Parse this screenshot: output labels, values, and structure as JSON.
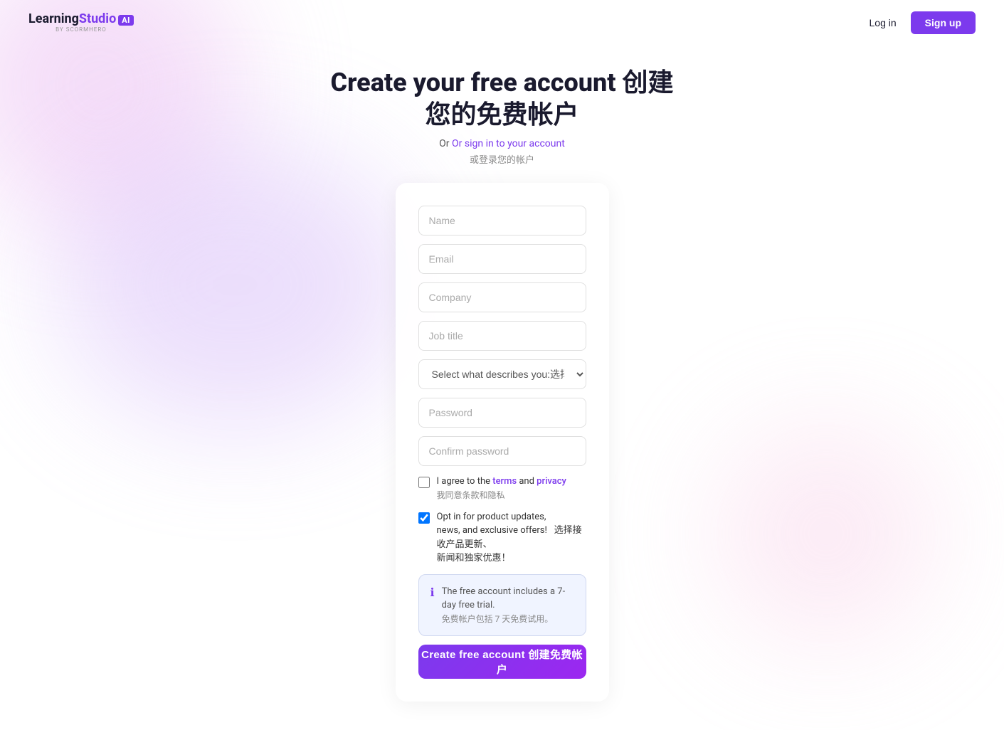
{
  "header": {
    "logo": {
      "learning": "Learning",
      "studio": "Studio",
      "ai": "AI",
      "byline": "by SCORMHERO"
    },
    "nav": {
      "login_label": "Log in",
      "signup_label": "Sign up"
    }
  },
  "page": {
    "title_en": "Create your free account 创建",
    "title_cn": "您的免费帐户",
    "subtitle_en": "Or sign in to your account",
    "subtitle_cn": "或登录您的帐户"
  },
  "form": {
    "name_placeholder": "Name",
    "email_placeholder": "Email",
    "company_placeholder": "Company",
    "job_title_placeholder": "Job title",
    "select_placeholder": "Select what describes you:选择描述您的内容",
    "password_placeholder": "Password",
    "confirm_password_placeholder": "Confirm password",
    "agree_text": "I agree to the ",
    "terms_label": "terms",
    "and_text": " and ",
    "privacy_label": "privacy",
    "agree_cn": "我同意条款和隐私",
    "optin_line1": "Opt in for product updates,",
    "optin_line2": "news, and exclusive offers!",
    "optin_cn1": "选择接收产品更新、",
    "optin_cn2": "新闻和独家优惠！",
    "info_en": "The free account includes a 7-day free trial.",
    "info_cn": "免费帐户包括 7 天免费试用。",
    "create_btn": "Create free account 创建免费帐户"
  }
}
